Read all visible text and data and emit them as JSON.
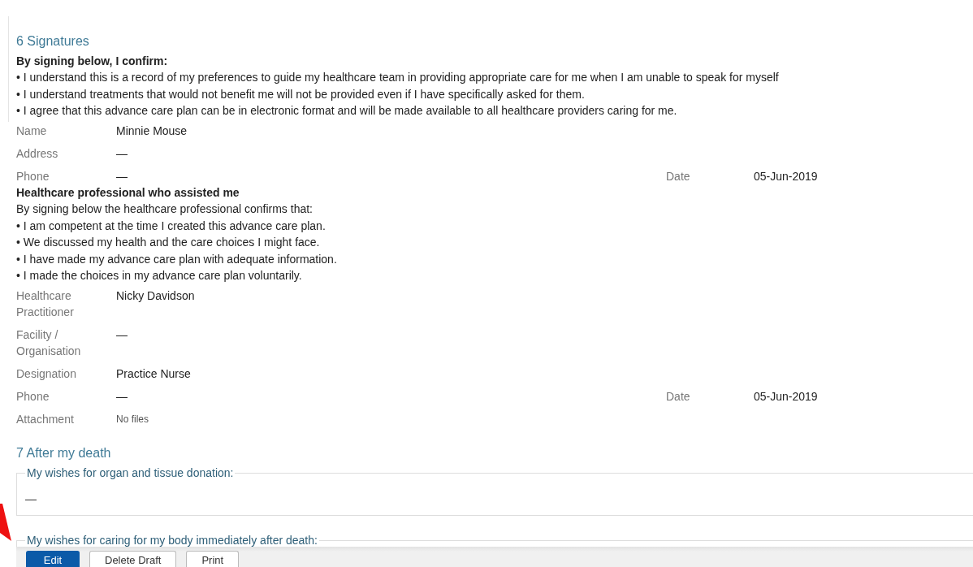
{
  "signatures": {
    "title": "6 Signatures",
    "confirm_heading": "By signing below, I confirm:",
    "confirm_items": [
      "• I understand this is a record of my preferences to guide my healthcare team in providing appropriate care for me when I am unable to speak for myself",
      "• I understand treatments that would not benefit me will not be provided even if I have specifically asked for them.",
      "• I agree that this advance care plan can be in electronic format and will be made available to all healthcare providers caring for me."
    ],
    "person_fields": [
      {
        "label": "Name",
        "value": "Minnie Mouse",
        "kind": "text"
      },
      {
        "label": "Address",
        "value": "—",
        "kind": "text"
      },
      {
        "label": "Phone",
        "value": "—",
        "kind": "text",
        "date_label": "Date",
        "date_value": "05-Jun-2019"
      }
    ],
    "professional_heading": "Healthcare professional who assisted me",
    "professional_intro": "By signing below the healthcare professional confirms that:",
    "professional_items": [
      "• I am competent at the time I created this advance care plan.",
      "• We discussed my health and the care choices I might face.",
      "• I have made my advance care plan with adequate information.",
      "• I made the choices in my advance care plan voluntarily."
    ],
    "professional_fields": [
      {
        "label": "Healthcare Practitioner",
        "value": "Nicky Davidson",
        "kind": "text"
      },
      {
        "label": "Facility / Organisation",
        "value": "—",
        "kind": "text"
      },
      {
        "label": "Designation",
        "value": "Practice Nurse",
        "kind": "text"
      },
      {
        "label": "Phone",
        "value": "—",
        "kind": "text",
        "date_label": "Date",
        "date_value": "05-Jun-2019"
      },
      {
        "label": "Attachment",
        "value": "No files",
        "kind": "attachment"
      }
    ]
  },
  "after_death": {
    "title": "7 After my death",
    "wishes": [
      {
        "legend": "My wishes for organ and tissue donation:",
        "value": "—"
      },
      {
        "legend": "My wishes for caring for my body immediately after death:"
      }
    ]
  },
  "buttons": [
    {
      "label": "Edit",
      "kind": "primary"
    },
    {
      "label": "Delete Draft",
      "kind": "secondary"
    },
    {
      "label": "Print",
      "kind": "secondary"
    }
  ]
}
